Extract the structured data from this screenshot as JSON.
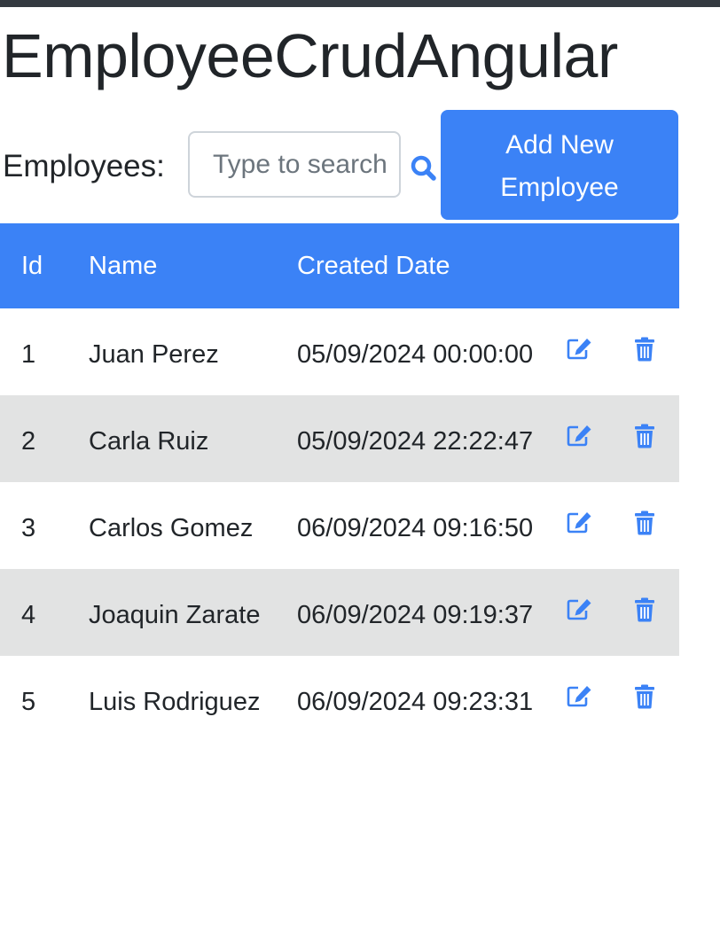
{
  "app": {
    "title": "EmployeeCrudAngular"
  },
  "toolbar": {
    "label": "Employees:",
    "search_placeholder": "Type to search",
    "search_value": "",
    "search_icon": "magnifier-icon",
    "add_button_label": "Add New Employee"
  },
  "table": {
    "headers": {
      "id": "Id",
      "name": "Name",
      "created": "Created Date"
    },
    "actions": {
      "edit_icon": "edit-icon",
      "delete_icon": "trash-icon"
    },
    "rows": [
      {
        "id": "1",
        "name": "Juan Perez",
        "created": "05/09/2024 00:00:00"
      },
      {
        "id": "2",
        "name": "Carla Ruiz",
        "created": "05/09/2024 22:22:47"
      },
      {
        "id": "3",
        "name": "Carlos Gomez",
        "created": "06/09/2024 09:16:50"
      },
      {
        "id": "4",
        "name": "Joaquin Zarate",
        "created": "06/09/2024 09:19:37"
      },
      {
        "id": "5",
        "name": "Luis Rodriguez",
        "created": "06/09/2024 09:23:31"
      }
    ]
  },
  "colors": {
    "primary": "#3b82f6",
    "stripe": "#e2e3e3",
    "topbar": "#343a40"
  }
}
